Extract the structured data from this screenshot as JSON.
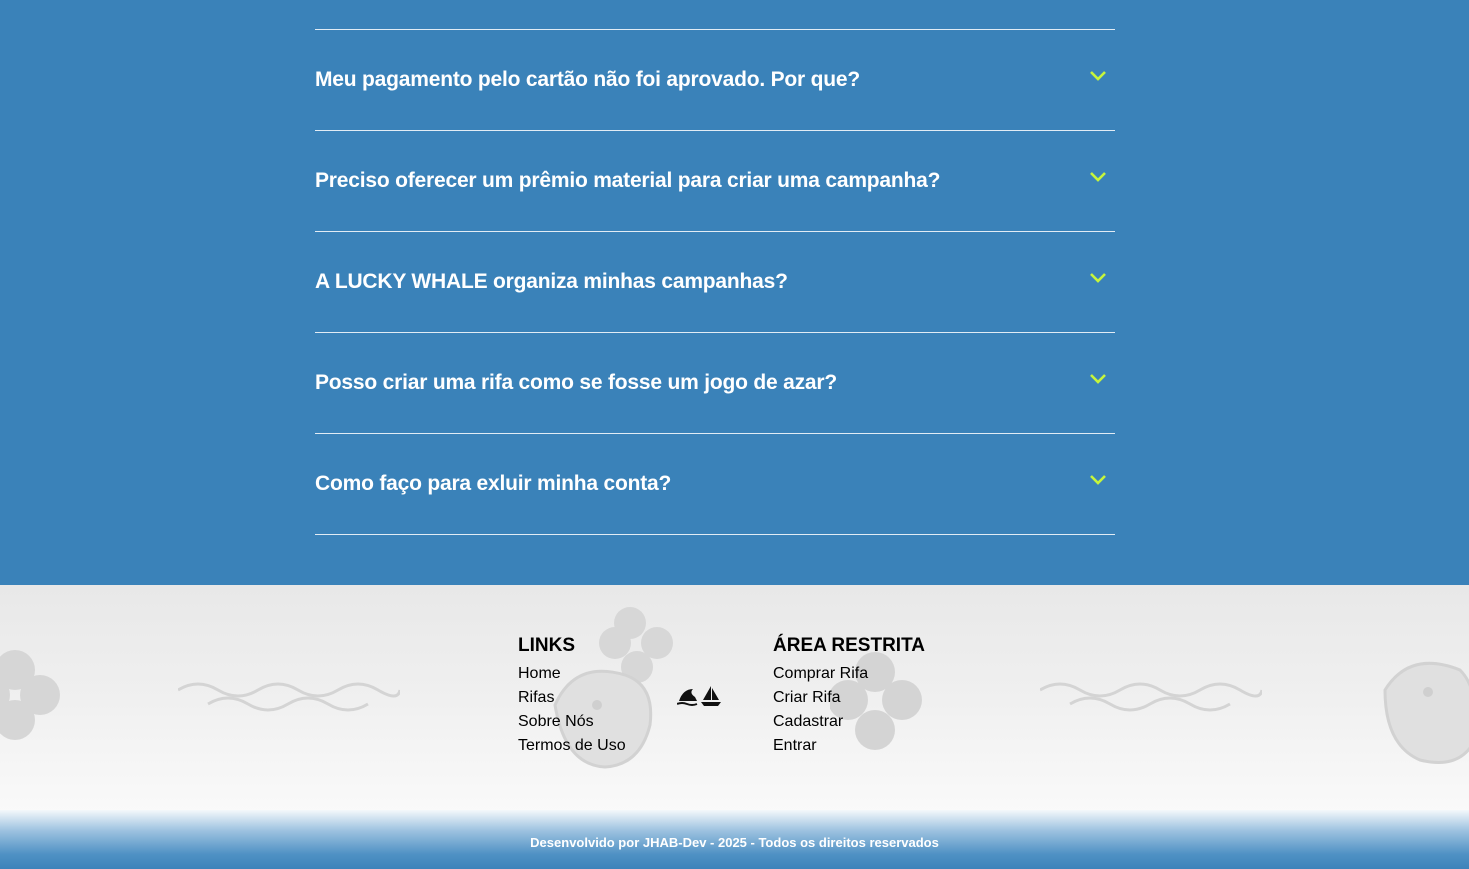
{
  "faq": {
    "questions": [
      "Meu pagamento pelo cartão não foi aprovado. Por que?",
      "Preciso oferecer um prêmio material para criar uma campanha?",
      "A LUCKY WHALE organiza minhas campanhas?",
      "Posso criar uma rifa como se fosse um jogo de azar?",
      "Como faço para exluir minha conta?"
    ],
    "chevron_color": "#c6f53b",
    "background": "#3a82b9"
  },
  "footer": {
    "links": {
      "title": "LINKS",
      "items": [
        "Home",
        "Rifas",
        "Sobre Nós",
        "Termos de Uso"
      ]
    },
    "restricted": {
      "title": "ÁREA RESTRITA",
      "items": [
        "Comprar Rifa",
        "Criar Rifa",
        "Cadastrar",
        "Entrar"
      ]
    },
    "copyright": "Desenvolvido por JHAB-Dev - 2025 - Todos os direitos reservados"
  }
}
